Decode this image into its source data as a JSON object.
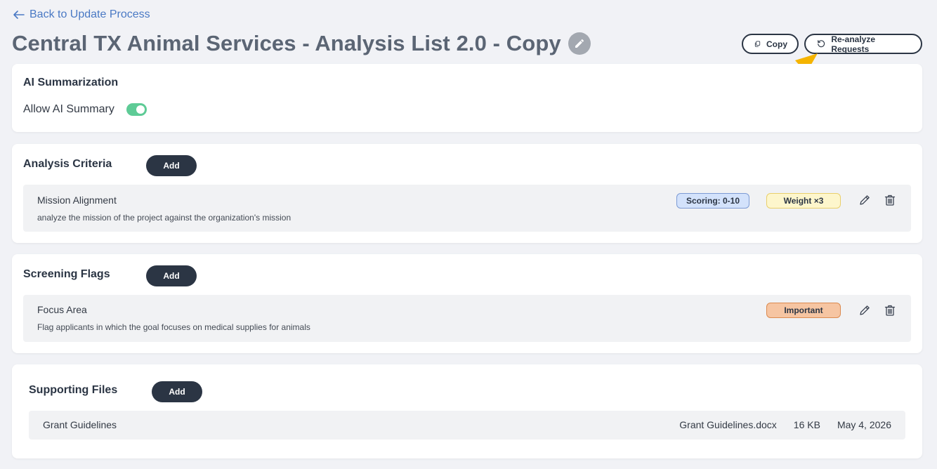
{
  "header": {
    "back_label": "Back to Update Process",
    "page_title": "Central TX Animal Services - Analysis List 2.0 - Copy",
    "copy_label": "Copy",
    "reanalyze_label": "Re-analyze Requests"
  },
  "ai_section": {
    "title": "AI Summarization",
    "toggle_label": "Allow AI Summary",
    "toggle_on": true
  },
  "criteria_section": {
    "title": "Analysis Criteria",
    "add_label": "Add",
    "items": [
      {
        "name": "Mission Alignment",
        "description": "analyze the mission of the project against the organization's mission",
        "scoring": "Scoring: 0-10",
        "weight": "Weight ×3"
      }
    ]
  },
  "flags_section": {
    "title": "Screening Flags",
    "add_label": "Add",
    "items": [
      {
        "name": "Focus Area",
        "description": "Flag applicants in which the goal focuses on medical supplies for animals",
        "priority": "Important"
      }
    ]
  },
  "files_section": {
    "title": "Supporting Files",
    "add_label": "Add",
    "files": [
      {
        "title": "Grant Guidelines",
        "filename": "Grant Guidelines.docx",
        "size": "16 KB",
        "date": "May 4, 2026"
      }
    ]
  },
  "colors": {
    "primary_dark": "#2b3544",
    "link_blue": "#4a79c4",
    "toggle_green": "#5ecb96",
    "annotation_arrow": "#f5b400"
  }
}
